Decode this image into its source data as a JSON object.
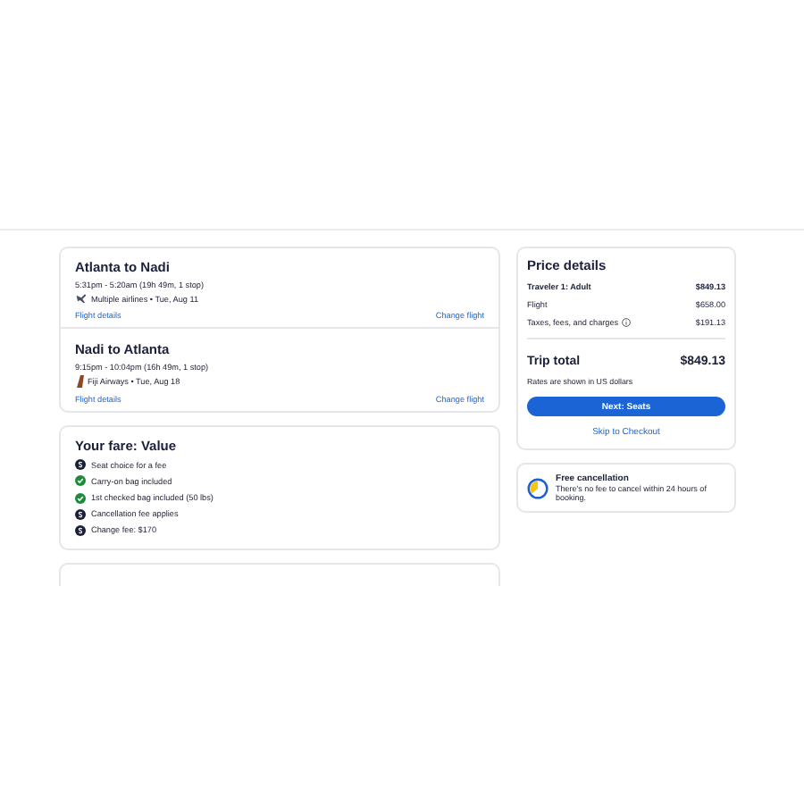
{
  "flights": [
    {
      "title": "Atlanta to Nadi",
      "times": "5:31pm - 5:20am (19h 49m, 1 stop)",
      "kind": "multiple",
      "airline": "Multiple airlines • Tue, Aug 11",
      "details_link": "Flight details",
      "change_link": "Change flight"
    },
    {
      "title": "Nadi to Atlanta",
      "times": "9:15pm - 10:04pm (16h 49m, 1 stop)",
      "kind": "tail",
      "airline": "Fiji Airways • Tue, Aug 18",
      "details_link": "Flight details",
      "change_link": "Change flight"
    }
  ],
  "fare": {
    "title": "Your fare: Value",
    "features": [
      {
        "kind": "fee",
        "text": "Seat choice for a fee"
      },
      {
        "kind": "included",
        "text": "Carry-on bag included"
      },
      {
        "kind": "included",
        "text": "1st checked bag included (50 lbs)"
      },
      {
        "kind": "fee",
        "text": "Cancellation fee applies"
      },
      {
        "kind": "fee",
        "text": "Change fee: $170"
      }
    ]
  },
  "price": {
    "title": "Price details",
    "lines": [
      {
        "kind": "header",
        "label": "Traveler 1: Adult",
        "amount": "$849.13"
      },
      {
        "kind": "plain",
        "label": "Flight",
        "amount": "$658.00"
      },
      {
        "kind": "info",
        "label": "Taxes, fees, and charges",
        "amount": "$191.13"
      }
    ],
    "total_label": "Trip total",
    "total": "$849.13",
    "note": "Rates are shown in US dollars",
    "next_button": "Next: Seats",
    "skip_link": "Skip to Checkout"
  },
  "cancellation": {
    "title": "Free cancellation",
    "text": "There's no fee to cancel within 24 hours of booking."
  }
}
